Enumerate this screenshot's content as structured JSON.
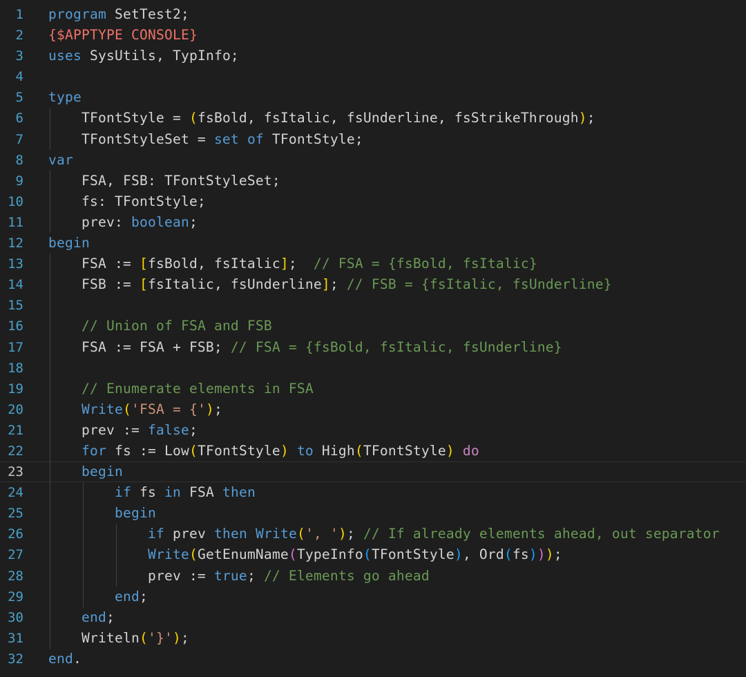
{
  "editor": {
    "lines": [
      {
        "n": "1",
        "indent": 0,
        "tokens": [
          [
            "kw",
            "program"
          ],
          [
            "id",
            " SetTest2;"
          ]
        ]
      },
      {
        "n": "2",
        "indent": 0,
        "tokens": [
          [
            "dir",
            "{$APPTYPE CONSOLE}"
          ]
        ]
      },
      {
        "n": "3",
        "indent": 0,
        "tokens": [
          [
            "kw",
            "uses"
          ],
          [
            "id",
            " SysUtils, TypInfo;"
          ]
        ]
      },
      {
        "n": "4",
        "indent": 0,
        "tokens": []
      },
      {
        "n": "5",
        "indent": 0,
        "tokens": [
          [
            "kw",
            "type"
          ]
        ]
      },
      {
        "n": "6",
        "indent": 1,
        "tokens": [
          [
            "id",
            "    TFontStyle = "
          ],
          [
            "p1",
            "("
          ],
          [
            "id",
            "fsBold, fsItalic, fsUnderline, fsStrikeThrough"
          ],
          [
            "p1",
            ")"
          ],
          [
            "id",
            ";"
          ]
        ]
      },
      {
        "n": "7",
        "indent": 1,
        "tokens": [
          [
            "id",
            "    TFontStyleSet = "
          ],
          [
            "kw",
            "set"
          ],
          [
            "id",
            " "
          ],
          [
            "kw",
            "of"
          ],
          [
            "id",
            " TFontStyle;"
          ]
        ]
      },
      {
        "n": "8",
        "indent": 0,
        "tokens": [
          [
            "kw",
            "var"
          ]
        ]
      },
      {
        "n": "9",
        "indent": 1,
        "tokens": [
          [
            "id",
            "    FSA, FSB: TFontStyleSet;"
          ]
        ]
      },
      {
        "n": "10",
        "indent": 1,
        "tokens": [
          [
            "id",
            "    fs: TFontStyle;"
          ]
        ]
      },
      {
        "n": "11",
        "indent": 1,
        "tokens": [
          [
            "id",
            "    prev: "
          ],
          [
            "kw",
            "boolean"
          ],
          [
            "id",
            ";"
          ]
        ]
      },
      {
        "n": "12",
        "indent": 0,
        "tokens": [
          [
            "kw",
            "begin"
          ]
        ]
      },
      {
        "n": "13",
        "indent": 1,
        "tokens": [
          [
            "id",
            "    FSA := "
          ],
          [
            "p1",
            "["
          ],
          [
            "id",
            "fsBold, fsItalic"
          ],
          [
            "p1",
            "]"
          ],
          [
            "id",
            ";  "
          ],
          [
            "cmt",
            "// FSA = {fsBold, fsItalic}"
          ]
        ]
      },
      {
        "n": "14",
        "indent": 1,
        "tokens": [
          [
            "id",
            "    FSB := "
          ],
          [
            "p1",
            "["
          ],
          [
            "id",
            "fsItalic, fsUnderline"
          ],
          [
            "p1",
            "]"
          ],
          [
            "id",
            "; "
          ],
          [
            "cmt",
            "// FSB = {fsItalic, fsUnderline}"
          ]
        ]
      },
      {
        "n": "15",
        "indent": 1,
        "tokens": []
      },
      {
        "n": "16",
        "indent": 1,
        "tokens": [
          [
            "id",
            "    "
          ],
          [
            "cmt",
            "// Union of FSA and FSB"
          ]
        ]
      },
      {
        "n": "17",
        "indent": 1,
        "tokens": [
          [
            "id",
            "    FSA := FSA + FSB; "
          ],
          [
            "cmt",
            "// FSA = {fsBold, fsItalic, fsUnderline}"
          ]
        ]
      },
      {
        "n": "18",
        "indent": 1,
        "tokens": []
      },
      {
        "n": "19",
        "indent": 1,
        "tokens": [
          [
            "id",
            "    "
          ],
          [
            "cmt",
            "// Enumerate elements in FSA"
          ]
        ]
      },
      {
        "n": "20",
        "indent": 1,
        "tokens": [
          [
            "id",
            "    "
          ],
          [
            "fn",
            "Write"
          ],
          [
            "p1",
            "("
          ],
          [
            "str",
            "'FSA = {'"
          ],
          [
            "p1",
            ")"
          ],
          [
            "id",
            ";"
          ]
        ]
      },
      {
        "n": "21",
        "indent": 1,
        "tokens": [
          [
            "id",
            "    prev := "
          ],
          [
            "kw",
            "false"
          ],
          [
            "id",
            ";"
          ]
        ]
      },
      {
        "n": "22",
        "indent": 1,
        "tokens": [
          [
            "id",
            "    "
          ],
          [
            "kw",
            "for"
          ],
          [
            "id",
            " fs := Low"
          ],
          [
            "p1",
            "("
          ],
          [
            "id",
            "TFontStyle"
          ],
          [
            "p1",
            ")"
          ],
          [
            "id",
            " "
          ],
          [
            "kw",
            "to"
          ],
          [
            "id",
            " High"
          ],
          [
            "p1",
            "("
          ],
          [
            "id",
            "TFontStyle"
          ],
          [
            "p1",
            ")"
          ],
          [
            "id",
            " "
          ],
          [
            "kw2",
            "do"
          ]
        ]
      },
      {
        "n": "23",
        "indent": 1,
        "current": true,
        "tokens": [
          [
            "id",
            "    "
          ],
          [
            "kw",
            "begin"
          ]
        ]
      },
      {
        "n": "24",
        "indent": 2,
        "tokens": [
          [
            "id",
            "        "
          ],
          [
            "kw",
            "if"
          ],
          [
            "id",
            " fs "
          ],
          [
            "kw",
            "in"
          ],
          [
            "id",
            " FSA "
          ],
          [
            "kw",
            "then"
          ]
        ]
      },
      {
        "n": "25",
        "indent": 2,
        "tokens": [
          [
            "id",
            "        "
          ],
          [
            "kw",
            "begin"
          ]
        ]
      },
      {
        "n": "26",
        "indent": 3,
        "tokens": [
          [
            "id",
            "            "
          ],
          [
            "kw",
            "if"
          ],
          [
            "id",
            " prev "
          ],
          [
            "kw",
            "then"
          ],
          [
            "id",
            " "
          ],
          [
            "fn",
            "Write"
          ],
          [
            "p1",
            "("
          ],
          [
            "str",
            "', '"
          ],
          [
            "p1",
            ")"
          ],
          [
            "id",
            "; "
          ],
          [
            "cmt",
            "// If already elements ahead, out separator"
          ]
        ]
      },
      {
        "n": "27",
        "indent": 3,
        "tokens": [
          [
            "id",
            "            "
          ],
          [
            "fn",
            "Write"
          ],
          [
            "p1",
            "("
          ],
          [
            "id",
            "GetEnumName"
          ],
          [
            "p2",
            "("
          ],
          [
            "id",
            "TypeInfo"
          ],
          [
            "p3",
            "("
          ],
          [
            "id",
            "TFontStyle"
          ],
          [
            "p3",
            ")"
          ],
          [
            "id",
            ", Ord"
          ],
          [
            "p3",
            "("
          ],
          [
            "id",
            "fs"
          ],
          [
            "p3",
            ")"
          ],
          [
            "p2",
            ")"
          ],
          [
            "p1",
            ")"
          ],
          [
            "id",
            ";"
          ]
        ]
      },
      {
        "n": "28",
        "indent": 3,
        "tokens": [
          [
            "id",
            "            prev := "
          ],
          [
            "kw",
            "true"
          ],
          [
            "id",
            "; "
          ],
          [
            "cmt",
            "// Elements go ahead"
          ]
        ]
      },
      {
        "n": "29",
        "indent": 2,
        "tokens": [
          [
            "id",
            "        "
          ],
          [
            "kw",
            "end"
          ],
          [
            "id",
            ";"
          ]
        ]
      },
      {
        "n": "30",
        "indent": 1,
        "tokens": [
          [
            "id",
            "    "
          ],
          [
            "kw",
            "end"
          ],
          [
            "id",
            ";"
          ]
        ]
      },
      {
        "n": "31",
        "indent": 1,
        "tokens": [
          [
            "id",
            "    Writeln"
          ],
          [
            "p1",
            "("
          ],
          [
            "str",
            "'}'"
          ],
          [
            "p1",
            ")"
          ],
          [
            "id",
            ";"
          ]
        ]
      },
      {
        "n": "32",
        "indent": 0,
        "tokens": [
          [
            "kw",
            "end"
          ],
          [
            "id",
            "."
          ]
        ]
      }
    ]
  }
}
